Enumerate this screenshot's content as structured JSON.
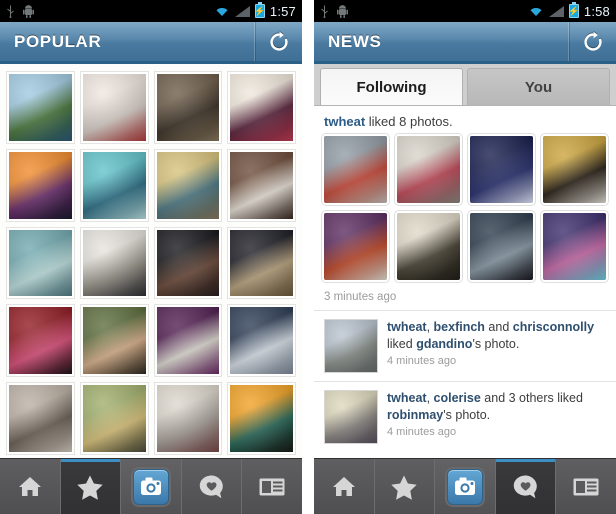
{
  "app": {
    "accent_blue": "#3b8fc4",
    "actionbar_blue": "#5b89ad",
    "link_blue": "#2b5c8a"
  },
  "left_phone": {
    "statusbar": {
      "usb_icon": "usb-icon",
      "android_icon": "android-robot-icon",
      "wifi_icon": "wifi-icon",
      "signal_icon": "cell-signal-icon",
      "battery_icon": "battery-charging-icon",
      "clock": "1:57"
    },
    "actionbar": {
      "title": "POPULAR",
      "refresh_icon": "refresh-icon"
    },
    "grid": {
      "photos": [
        {
          "alt": "tree-on-coastal-lawn",
          "c1": "#9fc9e0",
          "c2": "#4d7a3e",
          "c3": "#2c5a7a"
        },
        {
          "alt": "sketchbook-with-pencil-and-red-heart",
          "c1": "#efe6e0",
          "c2": "#d9cfc8",
          "c3": "#b23b3b"
        },
        {
          "alt": "elephant-close-up",
          "c1": "#6b5a46",
          "c2": "#3d3328",
          "c3": "#8c7a60"
        },
        {
          "alt": "marry-me-zayn-malik-shirt",
          "c1": "#efe7dc",
          "c2": "#5e2740",
          "c3": "#c23b54"
        },
        {
          "alt": "fiery-sunset-over-rocks",
          "c1": "#f08a2a",
          "c2": "#6b2f6e",
          "c3": "#1b1b2e"
        },
        {
          "alt": "dolphins-in-turquoise-water",
          "c1": "#5fc2c9",
          "c2": "#2d6f86",
          "c3": "#bfe4e4"
        },
        {
          "alt": "two-people-by-window",
          "c1": "#d6c27a",
          "c2": "#4e7a86",
          "c3": "#8a7a5e"
        },
        {
          "alt": "white-cat-lying-down",
          "c1": "#6b4a38",
          "c2": "#e8e2d8",
          "c3": "#3a2820"
        },
        {
          "alt": "two-babies-in-teal-floats",
          "c1": "#6fa8ae",
          "c2": "#bfe0df",
          "c3": "#4e7c84"
        },
        {
          "alt": "stormtrooper-figure-with-phone",
          "c1": "#e6e3dc",
          "c2": "#9a968c",
          "c3": "#2f2f33"
        },
        {
          "alt": "man-portrait-dark-background",
          "c1": "#141418",
          "c2": "#6b4a3a",
          "c3": "#2a2020"
        },
        {
          "alt": "lion-head-illustration",
          "c1": "#1a1a22",
          "c2": "#b9a37e",
          "c3": "#6b5a3e"
        },
        {
          "alt": "two-people-red-background-selfie",
          "c1": "#8f1820",
          "c2": "#d94f7a",
          "c3": "#1f1418"
        },
        {
          "alt": "woman-with-brooke-text",
          "c1": "#5a6b3a",
          "c2": "#d8b08a",
          "c3": "#2e2a20"
        },
        {
          "alt": "person-purple-background-striped-shirt",
          "c1": "#4e1c4e",
          "c2": "#e0dcd4",
          "c3": "#6b2a66"
        },
        {
          "alt": "city-street-with-lights",
          "c1": "#2a3a52",
          "c2": "#d8e0e8",
          "c3": "#7e8a9a"
        },
        {
          "alt": "couple-playful-portrait",
          "c1": "#b9aea2",
          "c2": "#6b6257",
          "c3": "#d8cfc4"
        },
        {
          "alt": "food-cart-street-scene",
          "c1": "#9fae6a",
          "c2": "#d8c27a",
          "c3": "#4a4a3a"
        },
        {
          "alt": "blonde-hair-close-up",
          "c1": "#dcd6cc",
          "c2": "#a8a09a",
          "c3": "#7a4a4a"
        },
        {
          "alt": "golden-clouds-at-sunset",
          "c1": "#f0a022",
          "c2": "#2a6b5a",
          "c3": "#1a1a16"
        }
      ]
    },
    "nav": {
      "items": [
        {
          "icon": "home-icon",
          "name": "nav-home",
          "selected": false
        },
        {
          "icon": "star-icon",
          "name": "nav-popular",
          "selected": true
        },
        {
          "icon": "camera-icon",
          "name": "nav-camera",
          "selected": false
        },
        {
          "icon": "heart-bubble-icon",
          "name": "nav-news",
          "selected": false
        },
        {
          "icon": "profile-card-icon",
          "name": "nav-profile",
          "selected": false
        }
      ]
    }
  },
  "right_phone": {
    "statusbar": {
      "usb_icon": "usb-icon",
      "android_icon": "android-robot-icon",
      "wifi_icon": "wifi-icon",
      "signal_icon": "cell-signal-icon",
      "battery_icon": "battery-charging-icon",
      "clock": "1:58"
    },
    "actionbar": {
      "title": "NEWS",
      "refresh_icon": "refresh-icon"
    },
    "tabs": [
      {
        "label": "Following",
        "active": true
      },
      {
        "label": "You",
        "active": false
      }
    ],
    "feed": {
      "liked_block": {
        "user": "twheat",
        "rest": " liked 8 photos.",
        "timestamp": "3 minutes ago",
        "thumbs": [
          {
            "alt": "garden-gnome-by-lake",
            "c1": "#8f9aa2",
            "c2": "#c94a3a",
            "c3": "#c8c4bc"
          },
          {
            "alt": "colorful-alley-with-lanterns",
            "c1": "#d8d2c8",
            "c2": "#c24a5a",
            "c3": "#8a8a82"
          },
          {
            "alt": "night-sky-with-stars",
            "c1": "#141a4a",
            "c2": "#2a3270",
            "c3": "#e8ecff"
          },
          {
            "alt": "people-dancing-indoors",
            "c1": "#c9a23a",
            "c2": "#2a2218",
            "c3": "#e8e4dc"
          },
          {
            "alt": "entrance-special-sign",
            "c1": "#5a2a5e",
            "c2": "#c24a2a",
            "c3": "#e8e2d8"
          },
          {
            "alt": "tree-silhouette-at-dusk",
            "c1": "#ded8c6",
            "c2": "#4a4436",
            "c3": "#22201a"
          },
          {
            "alt": "city-skyline-evening",
            "c1": "#2a3a4a",
            "c2": "#8a9aa6",
            "c3": "#1a1a20"
          },
          {
            "alt": "abstract-colorful-lights",
            "c1": "#3a2a6a",
            "c2": "#c86aa8",
            "c3": "#6acfe0"
          }
        ]
      },
      "stories": [
        {
          "thumb": {
            "alt": "aerial-city-view-with-clouds",
            "c1": "#b9c4cf",
            "c2": "#8a8f8a",
            "c3": "#6a6f70"
          },
          "parts": [
            {
              "t": "twheat",
              "bold": true
            },
            {
              "t": ", ",
              "bold": false
            },
            {
              "t": "bexfinch",
              "bold": true
            },
            {
              "t": " and ",
              "bold": false
            },
            {
              "t": "chrisconnolly",
              "bold": true
            },
            {
              "t": " liked ",
              "bold": false
            },
            {
              "t": "gdandino",
              "bold": true
            },
            {
              "t": "'s photo.",
              "bold": false
            }
          ],
          "timestamp": "4 minutes ago"
        },
        {
          "thumb": {
            "alt": "calm-beach-horizon",
            "c1": "#ded8bc",
            "c2": "#8f8a86",
            "c3": "#5a5260"
          },
          "parts": [
            {
              "t": "twheat",
              "bold": true
            },
            {
              "t": ", ",
              "bold": false
            },
            {
              "t": "colerise",
              "bold": true
            },
            {
              "t": " and 3 others liked ",
              "bold": false
            },
            {
              "t": "robinmay",
              "bold": true
            },
            {
              "t": "'s photo.",
              "bold": false
            }
          ],
          "timestamp": "4 minutes ago"
        }
      ]
    },
    "nav": {
      "items": [
        {
          "icon": "home-icon",
          "name": "nav-home",
          "selected": false
        },
        {
          "icon": "star-icon",
          "name": "nav-popular",
          "selected": false
        },
        {
          "icon": "camera-icon",
          "name": "nav-camera",
          "selected": false
        },
        {
          "icon": "heart-bubble-icon",
          "name": "nav-news",
          "selected": true
        },
        {
          "icon": "profile-card-icon",
          "name": "nav-profile",
          "selected": false
        }
      ]
    }
  }
}
